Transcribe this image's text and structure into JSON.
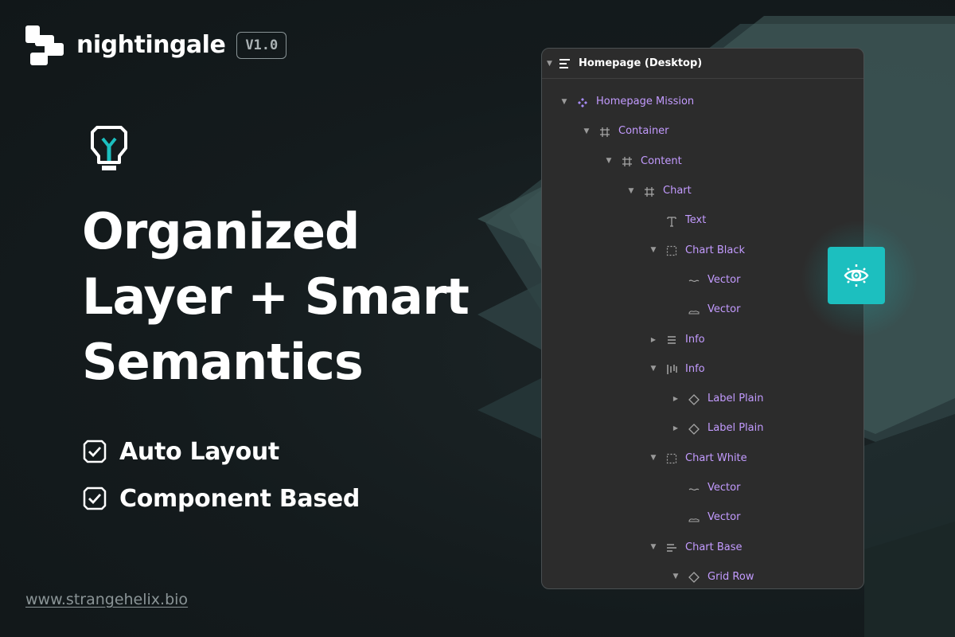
{
  "brand": {
    "name": "nightingale",
    "version": "V1.0"
  },
  "headline": {
    "line1": "Organized",
    "line2": "Layer + Smart",
    "line3": "Semantics"
  },
  "features": [
    {
      "label": "Auto Layout",
      "icon": "checkbox-checked-icon"
    },
    {
      "label": "Component Based",
      "icon": "checkbox-checked-icon"
    }
  ],
  "website": "www.strangehelix.bio",
  "colors": {
    "background": "#141b1d",
    "accent": "#1cbfbf",
    "layer_text": "#c39bff",
    "panel": "#2c2c2c"
  },
  "panel": {
    "title": "Homepage (Desktop)",
    "layers": [
      {
        "name": "Homepage Mission",
        "depth": 0,
        "expanded": "down",
        "icon": "component-icon"
      },
      {
        "name": "Container",
        "depth": 1,
        "expanded": "down",
        "icon": "frame-icon"
      },
      {
        "name": "Content",
        "depth": 2,
        "expanded": "down",
        "icon": "frame-icon"
      },
      {
        "name": "Chart",
        "depth": 3,
        "expanded": "down",
        "icon": "frame-icon"
      },
      {
        "name": "Text",
        "depth": 4,
        "expanded": "none",
        "icon": "text-icon"
      },
      {
        "name": "Chart Black",
        "depth": 4,
        "expanded": "down",
        "icon": "group-icon"
      },
      {
        "name": "Vector",
        "depth": 5,
        "expanded": "none",
        "icon": "vector-icon"
      },
      {
        "name": "Vector",
        "depth": 5,
        "expanded": "none",
        "icon": "vector-area-icon"
      },
      {
        "name": "Info",
        "depth": 4,
        "expanded": "right",
        "icon": "auto-layout-vertical-icon"
      },
      {
        "name": "Info",
        "depth": 4,
        "expanded": "down",
        "icon": "auto-layout-horizontal-icon"
      },
      {
        "name": "Label Plain",
        "depth": 5,
        "expanded": "right",
        "icon": "instance-icon"
      },
      {
        "name": "Label Plain",
        "depth": 5,
        "expanded": "right",
        "icon": "instance-icon"
      },
      {
        "name": "Chart White",
        "depth": 4,
        "expanded": "down",
        "icon": "group-icon"
      },
      {
        "name": "Vector",
        "depth": 5,
        "expanded": "none",
        "icon": "vector-icon"
      },
      {
        "name": "Vector",
        "depth": 5,
        "expanded": "none",
        "icon": "vector-area-icon"
      },
      {
        "name": "Chart Base",
        "depth": 4,
        "expanded": "down",
        "icon": "auto-layout-left-icon"
      },
      {
        "name": "Grid Row",
        "depth": 5,
        "expanded": "down",
        "icon": "instance-icon"
      }
    ]
  },
  "eye_button": {
    "icon": "eye-settings-icon"
  }
}
